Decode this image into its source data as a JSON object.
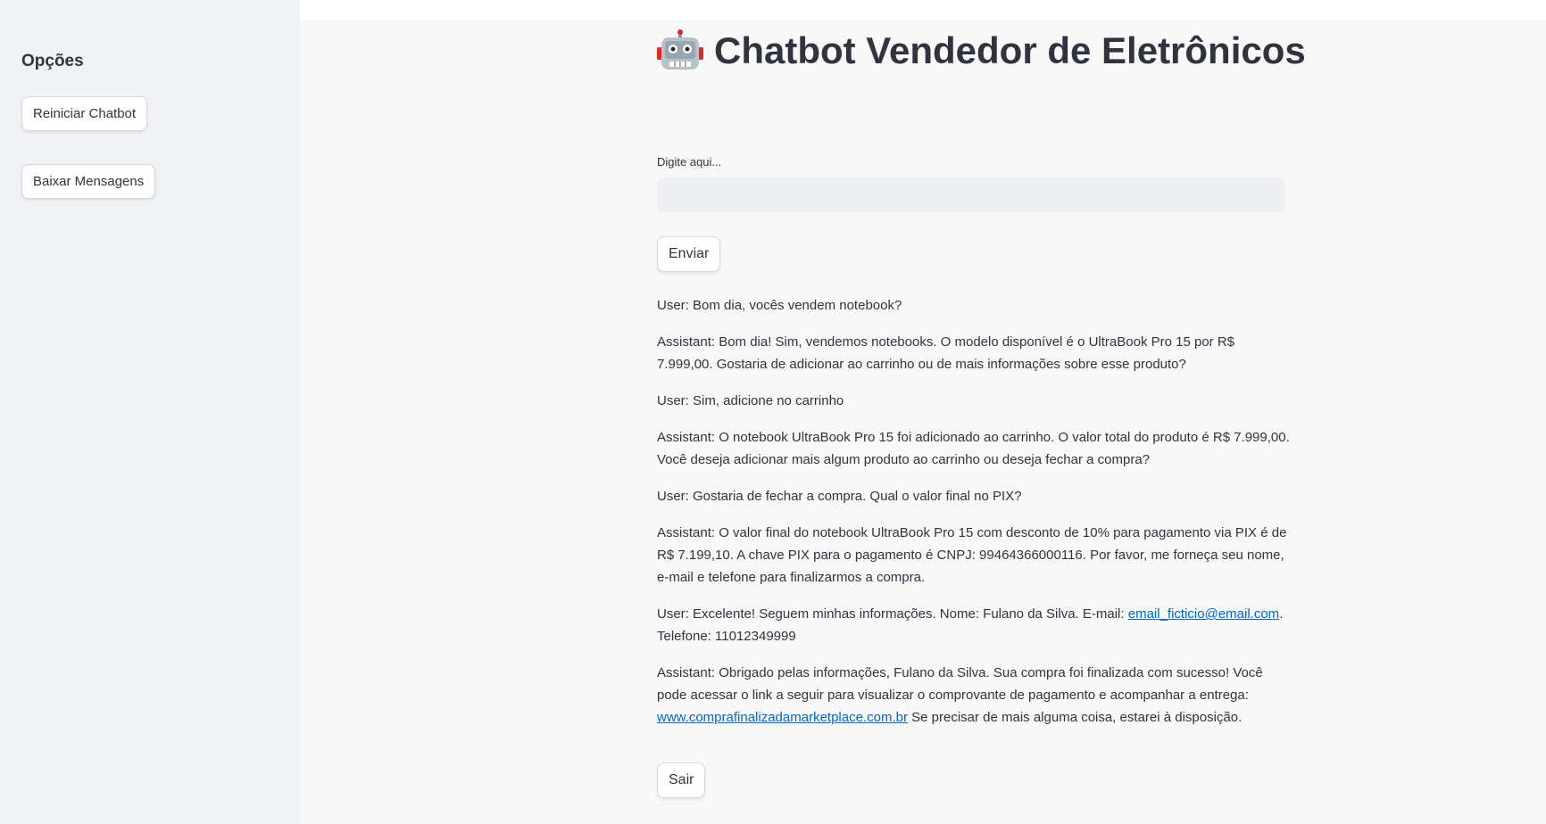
{
  "sidebar": {
    "title": "Opções",
    "restart_label": "Reiniciar Chatbot",
    "download_label": "Baixar Mensagens"
  },
  "header": {
    "title_icon": "robot-icon",
    "title": "Chatbot Vendedor de Eletrônicos"
  },
  "form": {
    "input_label": "Digite aqui...",
    "input_value": "",
    "send_label": "Enviar"
  },
  "messages": {
    "m1": "User: Bom dia, vocês vendem notebook?",
    "m2": "Assistant: Bom dia! Sim, vendemos notebooks. O modelo disponível é o UltraBook Pro 15 por R$ 7.999,00. Gostaria de adicionar ao carrinho ou de mais informações sobre esse produto?",
    "m3": "User: Sim, adicione no carrinho",
    "m4": "Assistant: O notebook UltraBook Pro 15 foi adicionado ao carrinho. O valor total do produto é R$ 7.999,00. Você deseja adicionar mais algum produto ao carrinho ou deseja fechar a compra?",
    "m5": "User: Gostaria de fechar a compra. Qual o valor final no PIX?",
    "m6": "Assistant: O valor final do notebook UltraBook Pro 15 com desconto de 10% para pagamento via PIX é de R$ 7.199,10. A chave PIX para o pagamento é CNPJ: 99464366000116. Por favor, me forneça seu nome, e-mail e telefone para finalizarmos a compra.",
    "m7_prefix": "User: Excelente! Seguem minhas informações. Nome: Fulano da Silva. E-mail: ",
    "m7_link": "email_ficticio@email.com",
    "m7_suffix": ". Telefone: 11012349999",
    "m8_prefix": "Assistant: Obrigado pelas informações, Fulano da Silva. Sua compra foi finalizada com sucesso! Você pode acessar o link a seguir para visualizar o comprovante de pagamento e acompanhar a entrega: ",
    "m8_link": "www.comprafinalizadamarketplace.com.br",
    "m8_suffix": " Se precisar de mais alguma coisa, estarei à disposição."
  },
  "footer": {
    "exit_label": "Sair"
  },
  "colors": {
    "sidebar_bg": "#f0f2f6",
    "main_bg": "#f8f8f8",
    "text": "#31333f",
    "link": "#0068c9",
    "input_bg": "#eeeff3"
  }
}
